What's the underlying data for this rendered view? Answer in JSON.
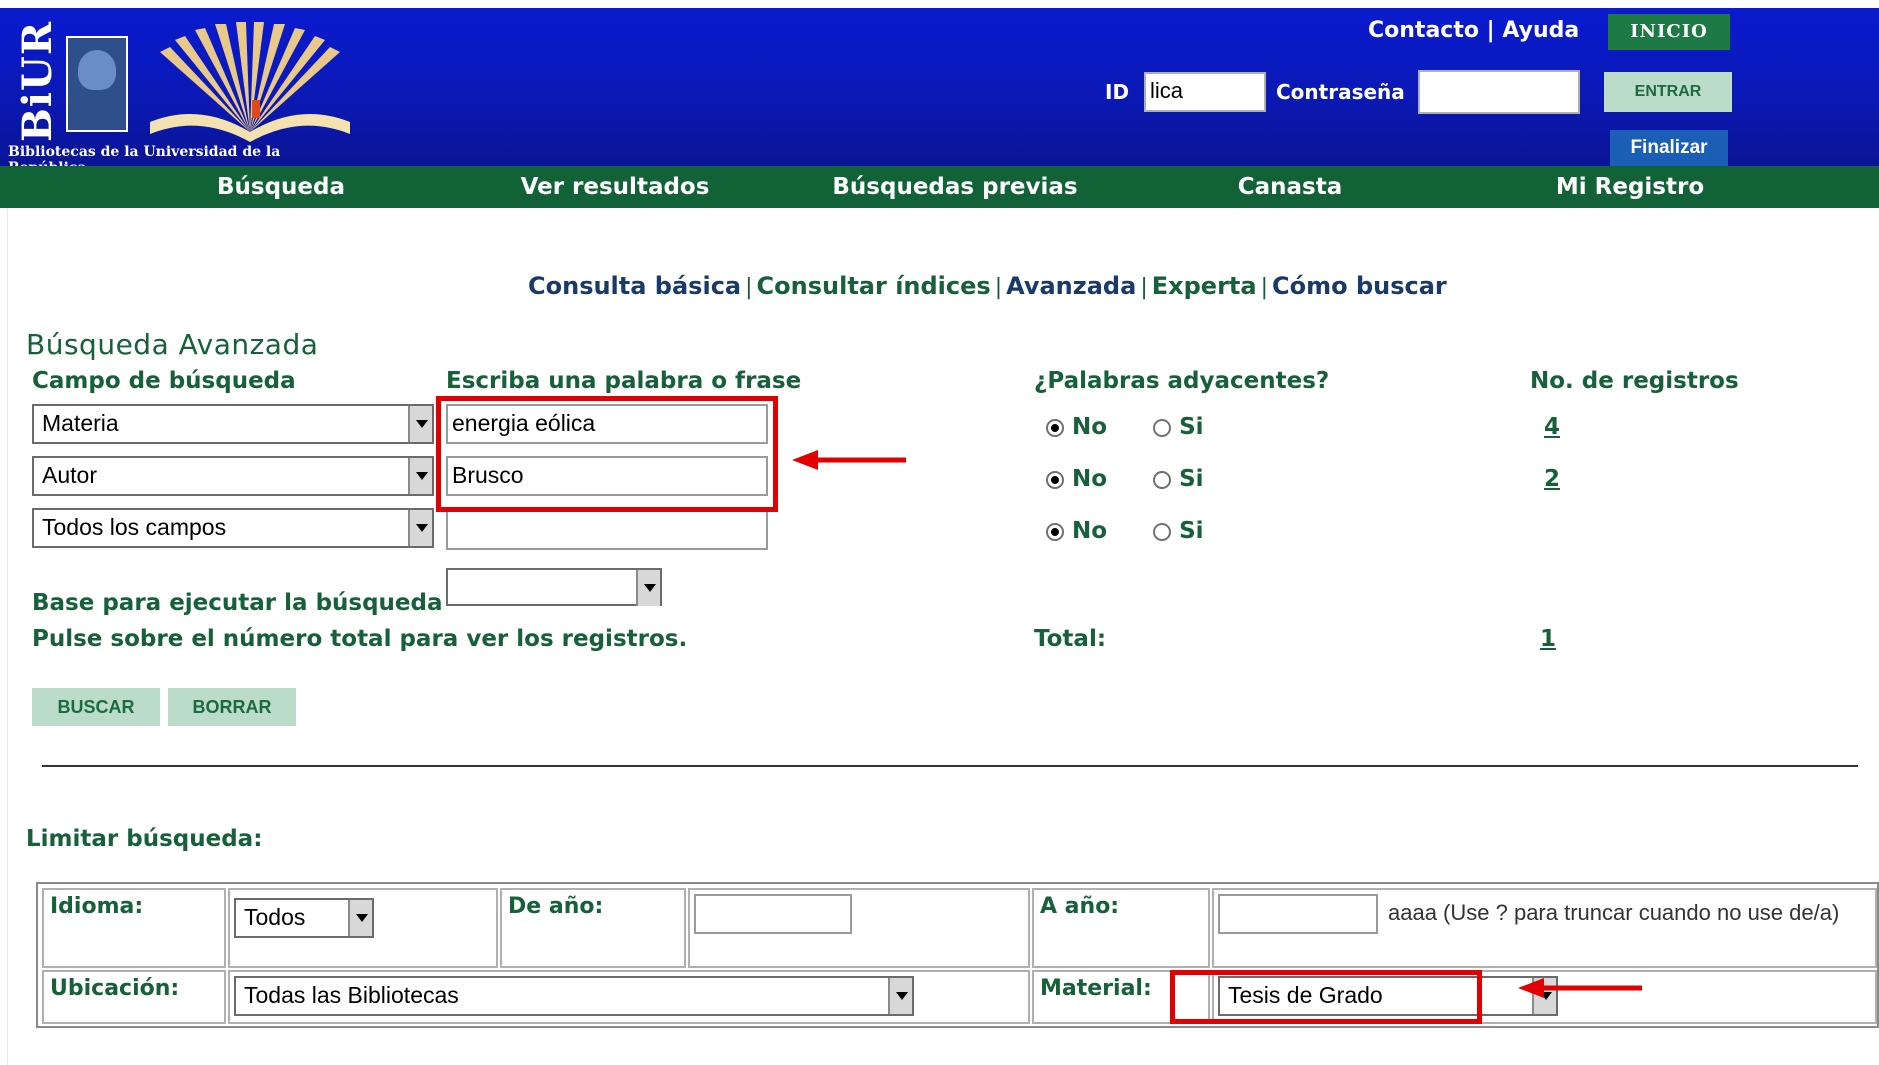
{
  "header": {
    "logo_text": "BiUR",
    "subtitle": "Bibliotecas de la Universidad de la República",
    "contact": "Contacto",
    "separator": "|",
    "help": "Ayuda",
    "home_button": "INICIO",
    "id_label": "ID",
    "id_value": "lica",
    "password_label": "Contraseña",
    "password_value": "",
    "login_button": "ENTRAR",
    "logout_button": "Finalizar"
  },
  "nav": {
    "items": [
      "Búsqueda",
      "Ver resultados",
      "Búsquedas previas",
      "Canasta",
      "Mi Registro"
    ]
  },
  "subnav": {
    "items": [
      "Consulta básica",
      "Consultar índices",
      "Avanzada",
      "Experta",
      "Cómo buscar"
    ],
    "separator": "|"
  },
  "search": {
    "title": "Búsqueda Avanzada",
    "col_field": "Campo de búsqueda",
    "col_term": "Escriba una palabra o frase",
    "col_adjacent": "¿Palabras adyacentes?",
    "col_records": "No. de registros",
    "rows": [
      {
        "field": "Materia",
        "term": "energia eólica",
        "adjacent_no": "No",
        "adjacent_si": "Si",
        "selected": "No",
        "records": "4"
      },
      {
        "field": "Autor",
        "term": "Brusco",
        "adjacent_no": "No",
        "adjacent_si": "Si",
        "selected": "No",
        "records": "2"
      },
      {
        "field": "Todos los campos",
        "term": "",
        "adjacent_no": "No",
        "adjacent_si": "Si",
        "selected": "No",
        "records": ""
      }
    ],
    "base_label": "Base para ejecutar la búsqueda",
    "base_value": "",
    "hint": "Pulse sobre el número total para ver los registros.",
    "total_label": "Total:",
    "total_value": "1",
    "search_button": "BUSCAR",
    "clear_button": "BORRAR"
  },
  "limit": {
    "title": "Limitar búsqueda:",
    "language_label": "Idioma:",
    "language_value": "Todos",
    "from_year_label": "De año:",
    "from_year_value": "",
    "to_year_label": "A año:",
    "to_year_value": "",
    "year_hint": "aaaa (Use ? para truncar cuando no use de/a)",
    "location_label": "Ubicación:",
    "location_value": "Todas las Bibliotecas",
    "material_label": "Material:",
    "material_value": "Tesis de Grado"
  },
  "colors": {
    "header_blue": "#0b19b6",
    "nav_green": "#116236",
    "text_green": "#16603a",
    "annotation_red": "#e30000"
  }
}
